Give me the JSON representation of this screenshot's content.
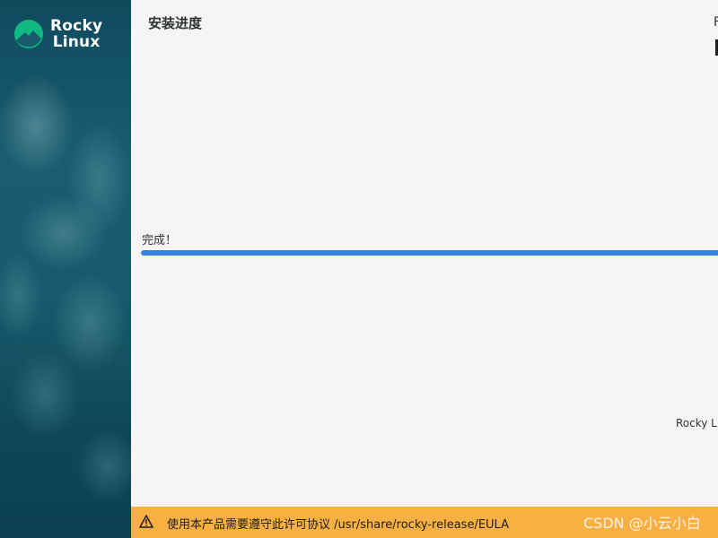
{
  "sidebar": {
    "logo_line1": "Rocky",
    "logo_line2": "Linux"
  },
  "header": {
    "title": "安装进度",
    "right_text": "F"
  },
  "progress": {
    "status_text": "完成！",
    "fraction": 1.0
  },
  "footer_text": "Rocky Li",
  "warning": {
    "icon": "warning-icon",
    "text": "使用本产品需要遵守此许可协议 /usr/share/rocky-release/EULA"
  },
  "watermark": "CSDN @小云小白",
  "colors": {
    "sidebar": "#175a6c",
    "logo_green": "#10b981",
    "progress": "#3584e4",
    "warning_bar": "#f8b042"
  }
}
